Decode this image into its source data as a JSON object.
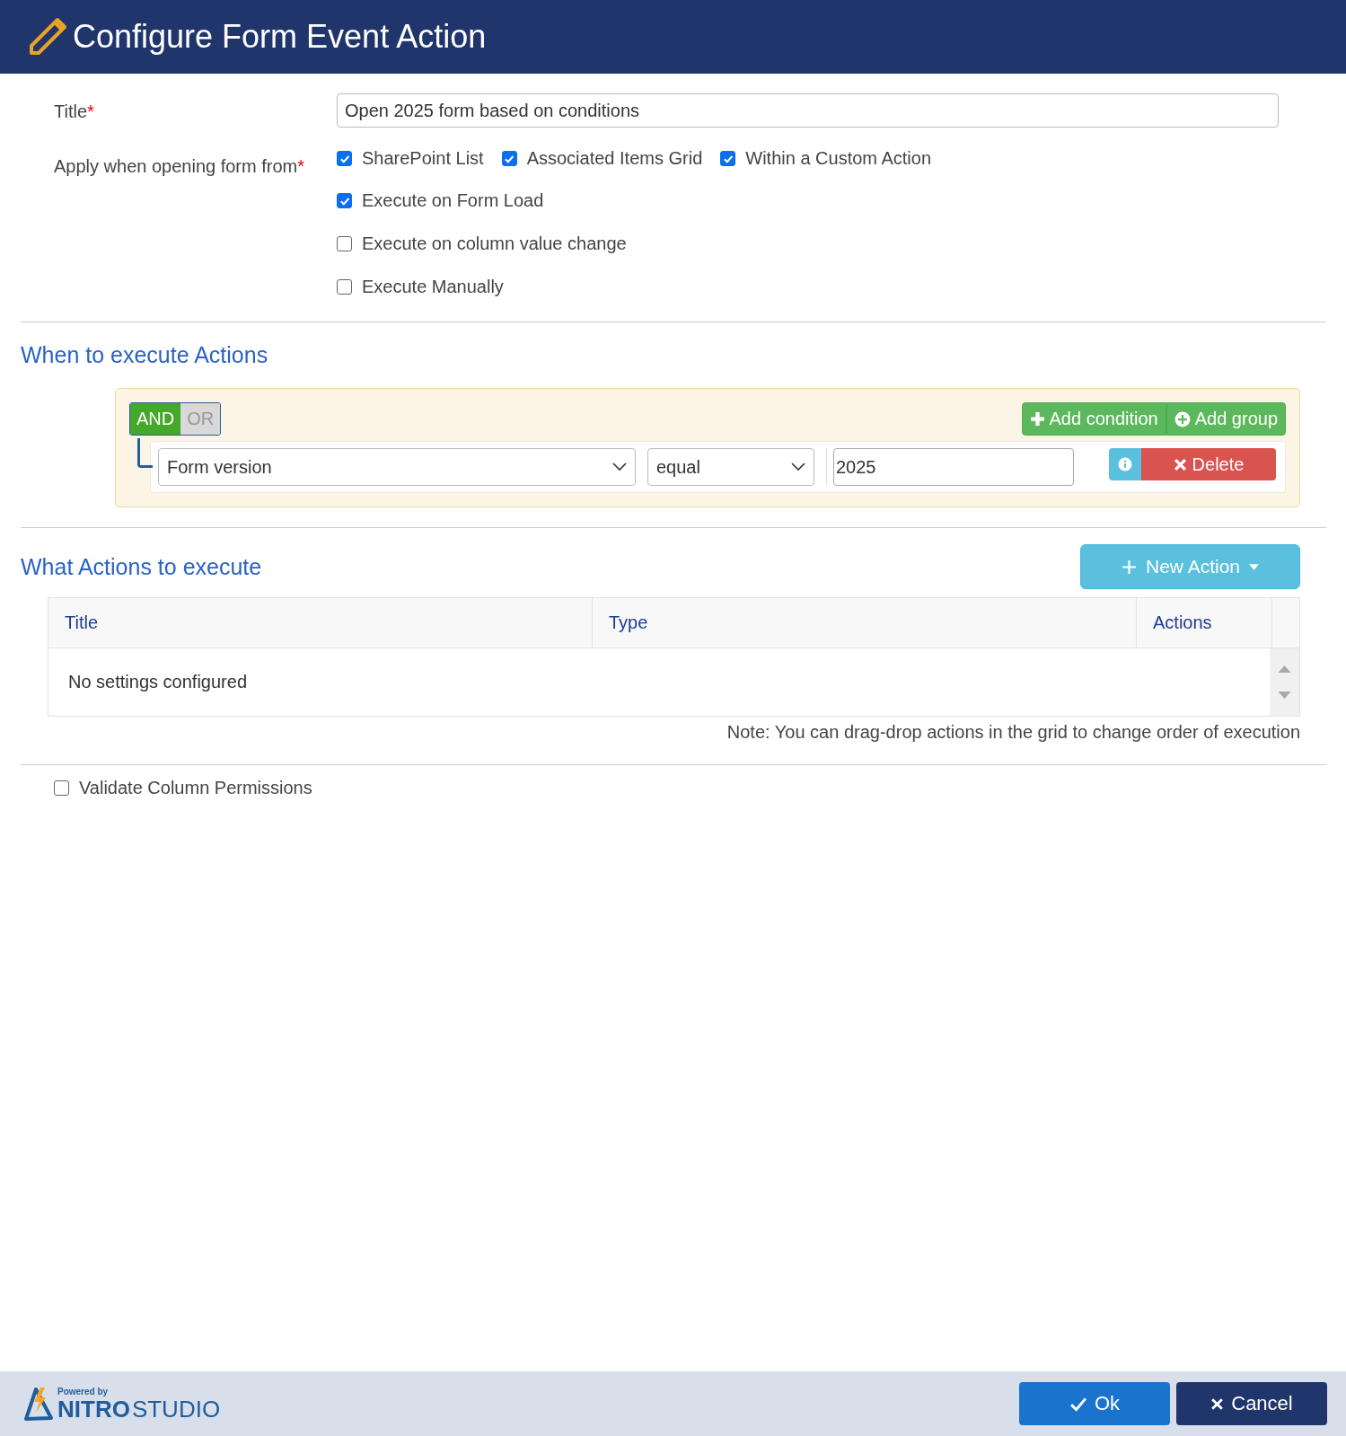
{
  "header": {
    "title": "Configure Form Event Action"
  },
  "form": {
    "title_label": "Title",
    "required_mark": "*",
    "title_value": "Open 2025 form based on conditions",
    "apply_label": "Apply when opening form from",
    "apply_required_mark": "*",
    "sources": [
      {
        "label": "SharePoint List",
        "checked": true
      },
      {
        "label": "Associated Items Grid",
        "checked": true
      },
      {
        "label": "Within a Custom Action",
        "checked": true
      }
    ],
    "options": [
      {
        "label": "Execute on Form Load",
        "checked": true
      },
      {
        "label": "Execute on column value change",
        "checked": false
      },
      {
        "label": "Execute Manually",
        "checked": false
      }
    ]
  },
  "conditions": {
    "heading": "When to execute Actions",
    "operators": [
      {
        "label": "AND",
        "selected": true
      },
      {
        "label": "OR",
        "selected": false
      }
    ],
    "add_condition": "Add condition",
    "add_group": "Add group",
    "rules": [
      {
        "field": "Form version",
        "operator": "equal",
        "value": "2025",
        "delete": "Delete"
      }
    ]
  },
  "actions": {
    "heading": "What Actions to execute",
    "new_action": "New Action",
    "columns": [
      "Title",
      "Type",
      "Actions"
    ],
    "empty": "No settings configured",
    "note": "Note: You can drag-drop actions in the grid to change order of execution"
  },
  "validate": {
    "label": "Validate Column Permissions",
    "checked": false
  },
  "footer": {
    "powered_by": "Powered by",
    "brand_bold": "NITRO",
    "brand": "STUDIO",
    "ok": "Ok",
    "cancel": "Cancel"
  }
}
